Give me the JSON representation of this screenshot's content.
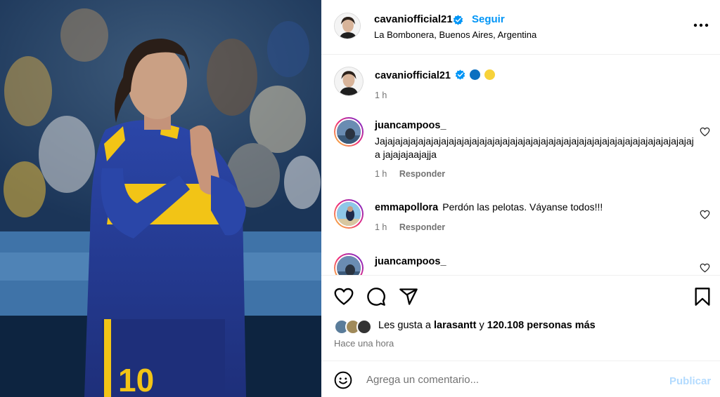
{
  "post": {
    "author": "cavaniofficial21",
    "follow_label": "Seguir",
    "separator": "•",
    "location": "La Bombonera, Buenos Aires, Argentina",
    "more_icon": "more-horizontal-icon"
  },
  "caption": {
    "author": "cavaniofficial21",
    "emoji_colors": [
      "#0b6fc0",
      "#f7d23a"
    ],
    "time": "1 h"
  },
  "comments": [
    {
      "username": "juancampoos_",
      "text": "Jajajajajajajajajajajajajajajajajajajajajajajajajajajajajajajajajajajajajajajajajaja jajajajaajajja",
      "time": "1 h",
      "reply_label": "Responder"
    },
    {
      "username": "emmapollora",
      "text": "Perdón las pelotas. Váyanse todos!!!",
      "time": "1 h",
      "reply_label": "Responder"
    },
    {
      "username": "juancampoos_",
      "text": "",
      "time": "",
      "reply_label": ""
    }
  ],
  "actions": {
    "icons": [
      "heart-icon",
      "comment-icon",
      "share-icon",
      "bookmark-icon"
    ]
  },
  "likes": {
    "prefix": "Les gusta a",
    "user": "larasantt",
    "connector": "y",
    "count_text": "120.108 personas más",
    "time_ago": "Hace una hora"
  },
  "add_comment": {
    "placeholder": "Agrega un comentario...",
    "publish_label": "Publicar"
  },
  "colors": {
    "link_blue": "#0095f6",
    "verified_blue": "#0095f6",
    "publish_disabled": "#b3dbff",
    "muted_text": "#737373"
  }
}
